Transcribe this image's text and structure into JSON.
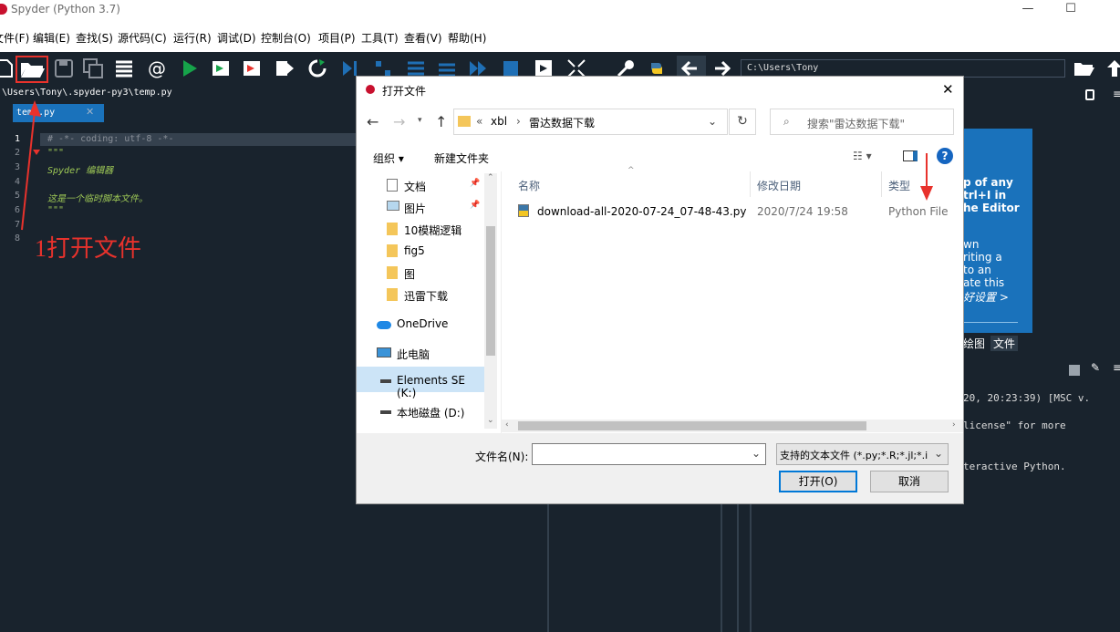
{
  "window": {
    "title": "Spyder (Python 3.7)",
    "min": "—",
    "max": "☐"
  },
  "menu": [
    {
      "label": "文件(F)"
    },
    {
      "label": "编辑(E)"
    },
    {
      "label": "查找(S)"
    },
    {
      "label": "源代码(C)"
    },
    {
      "label": "运行(R)"
    },
    {
      "label": "调试(D)"
    },
    {
      "label": "控制台(O)"
    },
    {
      "label": "项目(P)"
    },
    {
      "label": "工具(T)"
    },
    {
      "label": "查看(V)"
    },
    {
      "label": "帮助(H)"
    }
  ],
  "toolbar": {
    "cwd": "C:\\Users\\Tony"
  },
  "editor": {
    "path": "\\Users\\Tony\\.spyder-py3\\temp.py",
    "tab": "temp.py",
    "lines": [
      {
        "n": "1",
        "text": "# -*- coding: utf-8 -*-"
      },
      {
        "n": "2",
        "text": "\"\"\""
      },
      {
        "n": "3",
        "text": "Spyder 编辑器"
      },
      {
        "n": "4",
        "text": ""
      },
      {
        "n": "5",
        "text": "这是一个临时脚本文件。"
      },
      {
        "n": "6",
        "text": "\"\"\""
      },
      {
        "n": "7",
        "text": ""
      },
      {
        "n": "8",
        "text": ""
      }
    ],
    "annotation": "1打开文件"
  },
  "right": {
    "help_lines": [
      "p of any",
      "trl+I in",
      "he Editor",
      "",
      "wn",
      "riting a",
      "to an",
      "ate this",
      "好设置 >"
    ],
    "tabs": [
      "绘图",
      "文件"
    ],
    "console": [
      "20, 20:23:39) [MSC v.",
      "",
      "license\" for more",
      "",
      "",
      "teractive Python."
    ]
  },
  "dialog": {
    "title": "打开文件",
    "close": "✕",
    "breadcrumb": {
      "root": "«",
      "part1": "xbl",
      "sep": "›",
      "part2": "雷达数据下载"
    },
    "search_placeholder": "搜索\"雷达数据下载\"",
    "organize": "组织 ▾",
    "new_folder": "新建文件夹",
    "sidebar": [
      {
        "label": "文档",
        "pin": "📌"
      },
      {
        "label": "图片",
        "pin": "📌"
      },
      {
        "label": "10模糊逻辑"
      },
      {
        "label": "fig5"
      },
      {
        "label": "图"
      },
      {
        "label": "迅雷下载"
      },
      {
        "label": "OneDrive"
      },
      {
        "label": "此电脑"
      },
      {
        "label": "Elements SE (K:)"
      },
      {
        "label": "本地磁盘 (D:)"
      }
    ],
    "columns": {
      "name": "名称",
      "date": "修改日期",
      "type": "类型"
    },
    "files": [
      {
        "name": "download-all-2020-07-24_07-48-43.py",
        "date": "2020/7/24 19:58",
        "type": "Python File"
      }
    ],
    "filename_label": "文件名(N):",
    "filename_value": "",
    "filetype": "支持的文本文件 (*.py;*.R;*.jl;*.i",
    "open_btn": "打开(O)",
    "cancel_btn": "取消"
  },
  "colors": {
    "accent": "#e8322c",
    "dark": "#19232d",
    "link": "#0078d7"
  }
}
